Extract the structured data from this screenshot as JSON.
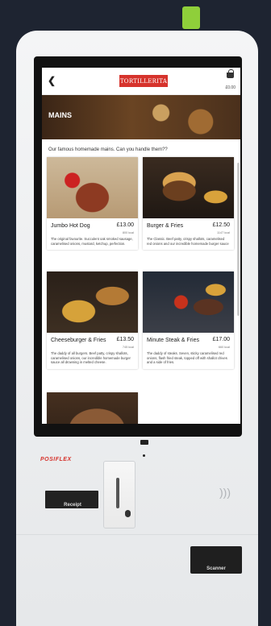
{
  "header": {
    "back_icon": "chevron-left",
    "logo_text": "TORTILLERITA",
    "basket_icon": "basket",
    "basket_total": "£0.00"
  },
  "hero": {
    "title": "MAINS"
  },
  "intro": "Our famous homemade mains. Can you handle them??",
  "menu": [
    {
      "name": "Jumbo Hot Dog",
      "price": "£13.00",
      "kcal": "800 kcal",
      "description": "The original favourite. Succulent oak smoked sausage, caramelised onions, mustard, ketchup, perfection."
    },
    {
      "name": "Burger & Fries",
      "price": "£12.50",
      "kcal": "1147 kcal",
      "description": "The Classic. Beef patty, crispy shallots, caramelised red onions and our incredible homemade burger sauce"
    },
    {
      "name": "Cheeseburger & Fries",
      "price": "£13.50",
      "kcal": "745 kcal",
      "description": "The daddy of all burgers. Beef patty, crispy shallots, caramelised onions, our incredible homemade burger sauce all drowning in melted cheese."
    },
    {
      "name": "Minute Steak & Fries",
      "price": "£17.00",
      "kcal": "660 kcal",
      "description": "The daddy of steaks. Seven, sticky caramelised red onions, flash fried steak, topped off with shallot chives and a side of fries."
    }
  ],
  "kiosk": {
    "brand": "POSIFLEX",
    "receipt_label": "Receipt",
    "scanner_label": "Scanner",
    "nfc_icon": "contactless",
    "led_color": "#8fcf3a",
    "accent_color": "#d6332c"
  }
}
